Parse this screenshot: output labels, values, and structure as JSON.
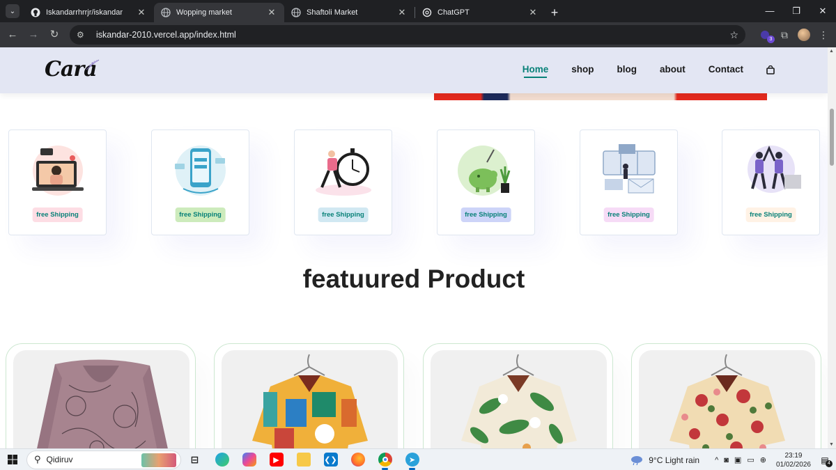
{
  "browser": {
    "tabs": [
      {
        "title": "Iskandarrhrrjr/iskandar",
        "icon": "github-icon"
      },
      {
        "title": "Wopping market",
        "icon": "globe-icon"
      },
      {
        "title": "Shaftoli Market",
        "icon": "globe-icon"
      },
      {
        "title": "ChatGPT",
        "icon": "chatgpt-icon"
      }
    ],
    "active_tab": 1,
    "url": "iskandar-2010.vercel.app/index.html",
    "extension_badge": "3"
  },
  "site": {
    "logo_text": "Cara",
    "nav": [
      {
        "label": "Home",
        "active": true
      },
      {
        "label": "shop"
      },
      {
        "label": "blog"
      },
      {
        "label": "about"
      },
      {
        "label": "Contact"
      }
    ],
    "features": [
      {
        "label": "free Shipping",
        "tag_color": "#fddde4"
      },
      {
        "label": "free Shipping",
        "tag_color": "#cdebbc"
      },
      {
        "label": "free Shipping",
        "tag_color": "#d1e8f2"
      },
      {
        "label": "free Shipping",
        "tag_color": "#cdd4f8"
      },
      {
        "label": "free Shipping",
        "tag_color": "#f6dbf6"
      },
      {
        "label": "free Shipping",
        "tag_color": "#fff2e5"
      }
    ],
    "section_title": "featuured Product",
    "accent_color": "#088178"
  },
  "taskbar": {
    "search_placeholder": "Qidiruv",
    "weather": "9°C  Light rain",
    "time": "23:19",
    "date": "01/02/2026",
    "notification_count": "4"
  }
}
